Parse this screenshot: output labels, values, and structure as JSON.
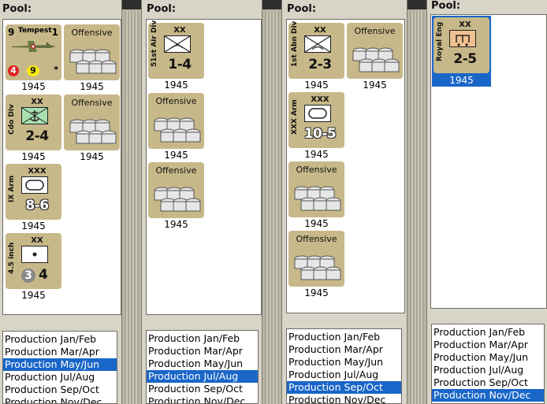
{
  "pools": [
    {
      "label": "Pool:",
      "list": [
        "Production Jan/Feb",
        "Production Mar/Apr",
        "Production May/Jun",
        "Production Jul/Aug",
        "Production Sep/Oct",
        "Production Nov/Dec"
      ],
      "selected_index": 2
    },
    {
      "label": "Pool:",
      "list": [
        "Production Jan/Feb",
        "Production Mar/Apr",
        "Production May/Jun",
        "Production Jul/Aug",
        "Production Sep/Oct",
        "Production Nov/Dec"
      ],
      "selected_index": 3
    },
    {
      "label": "Pool:",
      "list": [
        "Production Jan/Feb",
        "Production Mar/Apr",
        "Production May/Jun",
        "Production Jul/Aug",
        "Production Sep/Oct",
        "Production Nov/Dec"
      ],
      "selected_index": 4
    },
    {
      "label": "Pool:",
      "list": [
        "Production Jan/Feb",
        "Production Mar/Apr",
        "Production May/Jun",
        "Production Jul/Aug",
        "Production Sep/Oct",
        "Production Nov/Dec"
      ],
      "selected_index": 5
    }
  ],
  "counters": {
    "tempest": {
      "name": "Tempest",
      "left": "9",
      "right": "1",
      "red": "4",
      "yellow": "9",
      "star": "*",
      "year": "1945"
    },
    "offensive": "Offensive",
    "year": "1945",
    "cdo_div": {
      "side": "Cdo Div",
      "size": "XX",
      "str": "2-4",
      "year": "1945"
    },
    "ix_arm": {
      "side": "IX Arm",
      "size": "XXX",
      "str": "8-6",
      "year": "1945"
    },
    "inch45": {
      "side": "4.5 inch",
      "size": "XX",
      "gray": "3",
      "str": "4",
      "year": "1945"
    },
    "air51": {
      "side": "51st Air Div",
      "size": "XX",
      "str": "1-4",
      "year": "1945"
    },
    "abn1": {
      "side": "1st Abn Div",
      "size": "XX",
      "str": "2-3",
      "year": "1945"
    },
    "xxx_arm": {
      "side": "XXX Arm",
      "size": "XXX",
      "str": "10-5",
      "year": "1945"
    },
    "royal_eng": {
      "side": "Royal Eng",
      "size": "XX",
      "str": "2-5",
      "year": "1945"
    }
  },
  "colors": {
    "counter_tan": "#c7b889",
    "selection_blue": "#1a66c8",
    "red_badge": "#e02020",
    "yellow_badge": "#f5ea12"
  }
}
